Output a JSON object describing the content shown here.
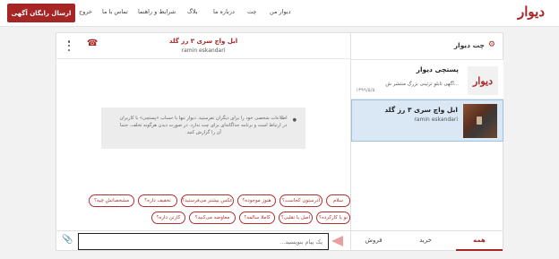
{
  "header": {
    "logo": "دیوار",
    "post_button": "ارسال رایگان آگهی",
    "nav": [
      "دیوار من",
      "چت",
      "درباره ما",
      "بلاگ",
      "شرایط و راهنما",
      "تماس با ما",
      "خروج"
    ]
  },
  "sidebar": {
    "title": "چت دیوار",
    "conversations": [
      {
        "thumb_text": "دیوار",
        "title": "پستچی دیوار",
        "subtitle": "آگهی تابلو تزئینی بزرگ منتشر ش...",
        "date": "۱۳۹۹/۵/۵"
      },
      {
        "title": "ابل واچ سری ۳ رز گلد",
        "subtitle": "ramin eskandari"
      }
    ],
    "tabs": [
      "همه",
      "خرید",
      "فروش"
    ],
    "active_tab": "همه"
  },
  "chat": {
    "title": "ابل واچ سری ۳ رز گلد",
    "subtitle": "ramin eskandari",
    "notice": "اطلاعات شخصی خود را برای دیگران نفرستید. دیوار تنها با حساب «پستچی» با کاربران در ارتباط است و برنامه جداگانه‌ای برای چت ندارد. در صورت دیدن هرگونه تخلف، حتما آن را گزارش کنید.",
    "quick_replies_row1": [
      "سلام",
      "آدرستون کجاست؟",
      "هنوز موجوده؟",
      "عکس بیشتر می‌فرستید؟",
      "تخفیف داره؟",
      "مشخصاتش چیه؟"
    ],
    "quick_replies_row2": [
      "نو یا کارکرده؟",
      "اصل یا تقلبی؟",
      "کاملا سالمه؟",
      "معاوضه می‌کنید؟",
      "کارتن داره؟"
    ],
    "input_placeholder": "یک پیام بنویسید...",
    "colors": {
      "accent": "#a62626"
    }
  }
}
